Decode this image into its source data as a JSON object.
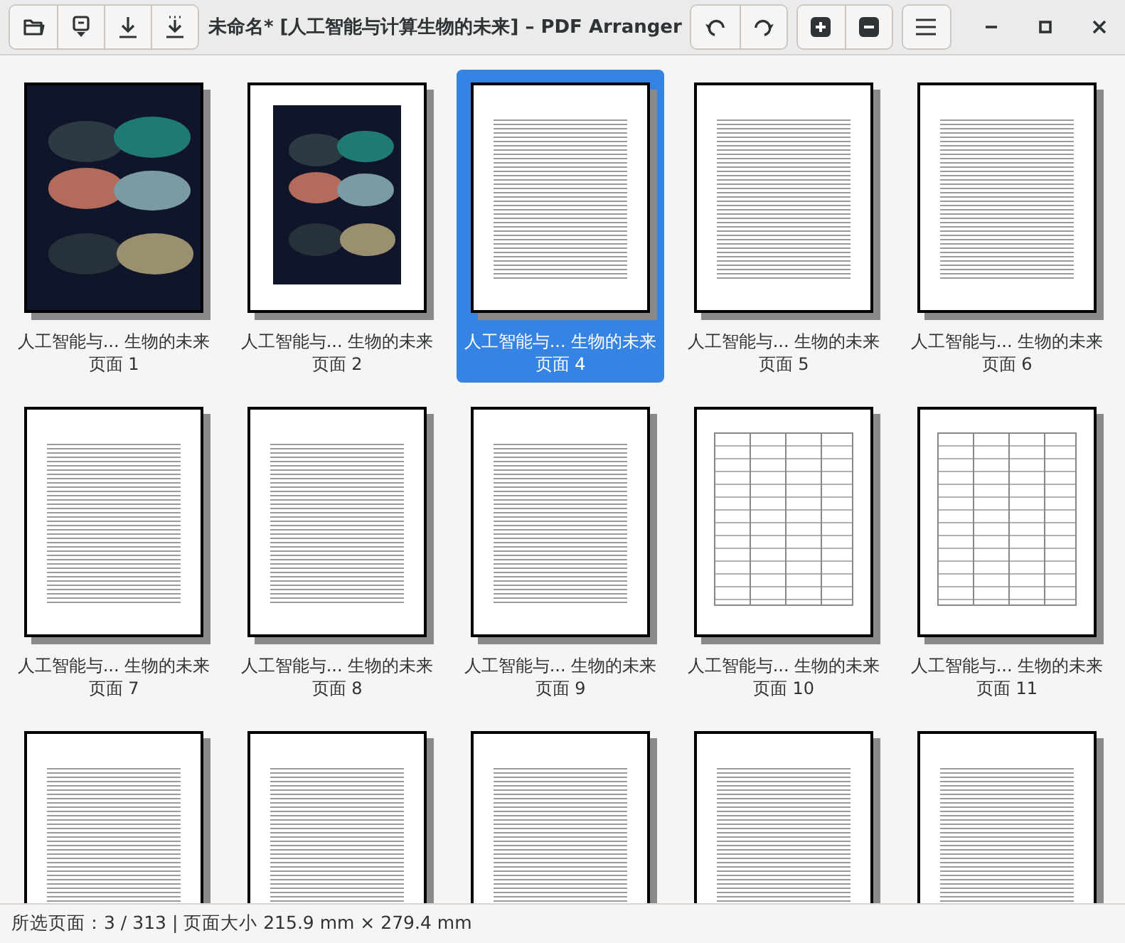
{
  "window": {
    "title": "未命名* [人工智能与计算生物的未来] – PDF Arranger"
  },
  "pages": [
    {
      "kind": "cover",
      "title": "人工智能与... 生物的未来",
      "label": "页面 1",
      "selected": false
    },
    {
      "kind": "cover-framed",
      "title": "人工智能与... 生物的未来",
      "label": "页面 2",
      "selected": false
    },
    {
      "kind": "text",
      "title": "人工智能与... 生物的未来",
      "label": "页面 4",
      "selected": true
    },
    {
      "kind": "text",
      "title": "人工智能与... 生物的未来",
      "label": "页面 5",
      "selected": false
    },
    {
      "kind": "text",
      "title": "人工智能与... 生物的未来",
      "label": "页面 6",
      "selected": false
    },
    {
      "kind": "text",
      "title": "人工智能与... 生物的未来",
      "label": "页面 7",
      "selected": false
    },
    {
      "kind": "text",
      "title": "人工智能与... 生物的未来",
      "label": "页面 8",
      "selected": false
    },
    {
      "kind": "text",
      "title": "人工智能与... 生物的未来",
      "label": "页面 9",
      "selected": false
    },
    {
      "kind": "table",
      "title": "人工智能与... 生物的未来",
      "label": "页面 10",
      "selected": false
    },
    {
      "kind": "table",
      "title": "人工智能与... 生物的未来",
      "label": "页面 11",
      "selected": false
    },
    {
      "kind": "text",
      "selected": false
    },
    {
      "kind": "text",
      "selected": false
    },
    {
      "kind": "text",
      "selected": false
    },
    {
      "kind": "text",
      "selected": false
    },
    {
      "kind": "text",
      "selected": false
    }
  ],
  "status_bar": "所选页面：3 / 313 | 页面大小 215.9 mm × 279.4 mm"
}
